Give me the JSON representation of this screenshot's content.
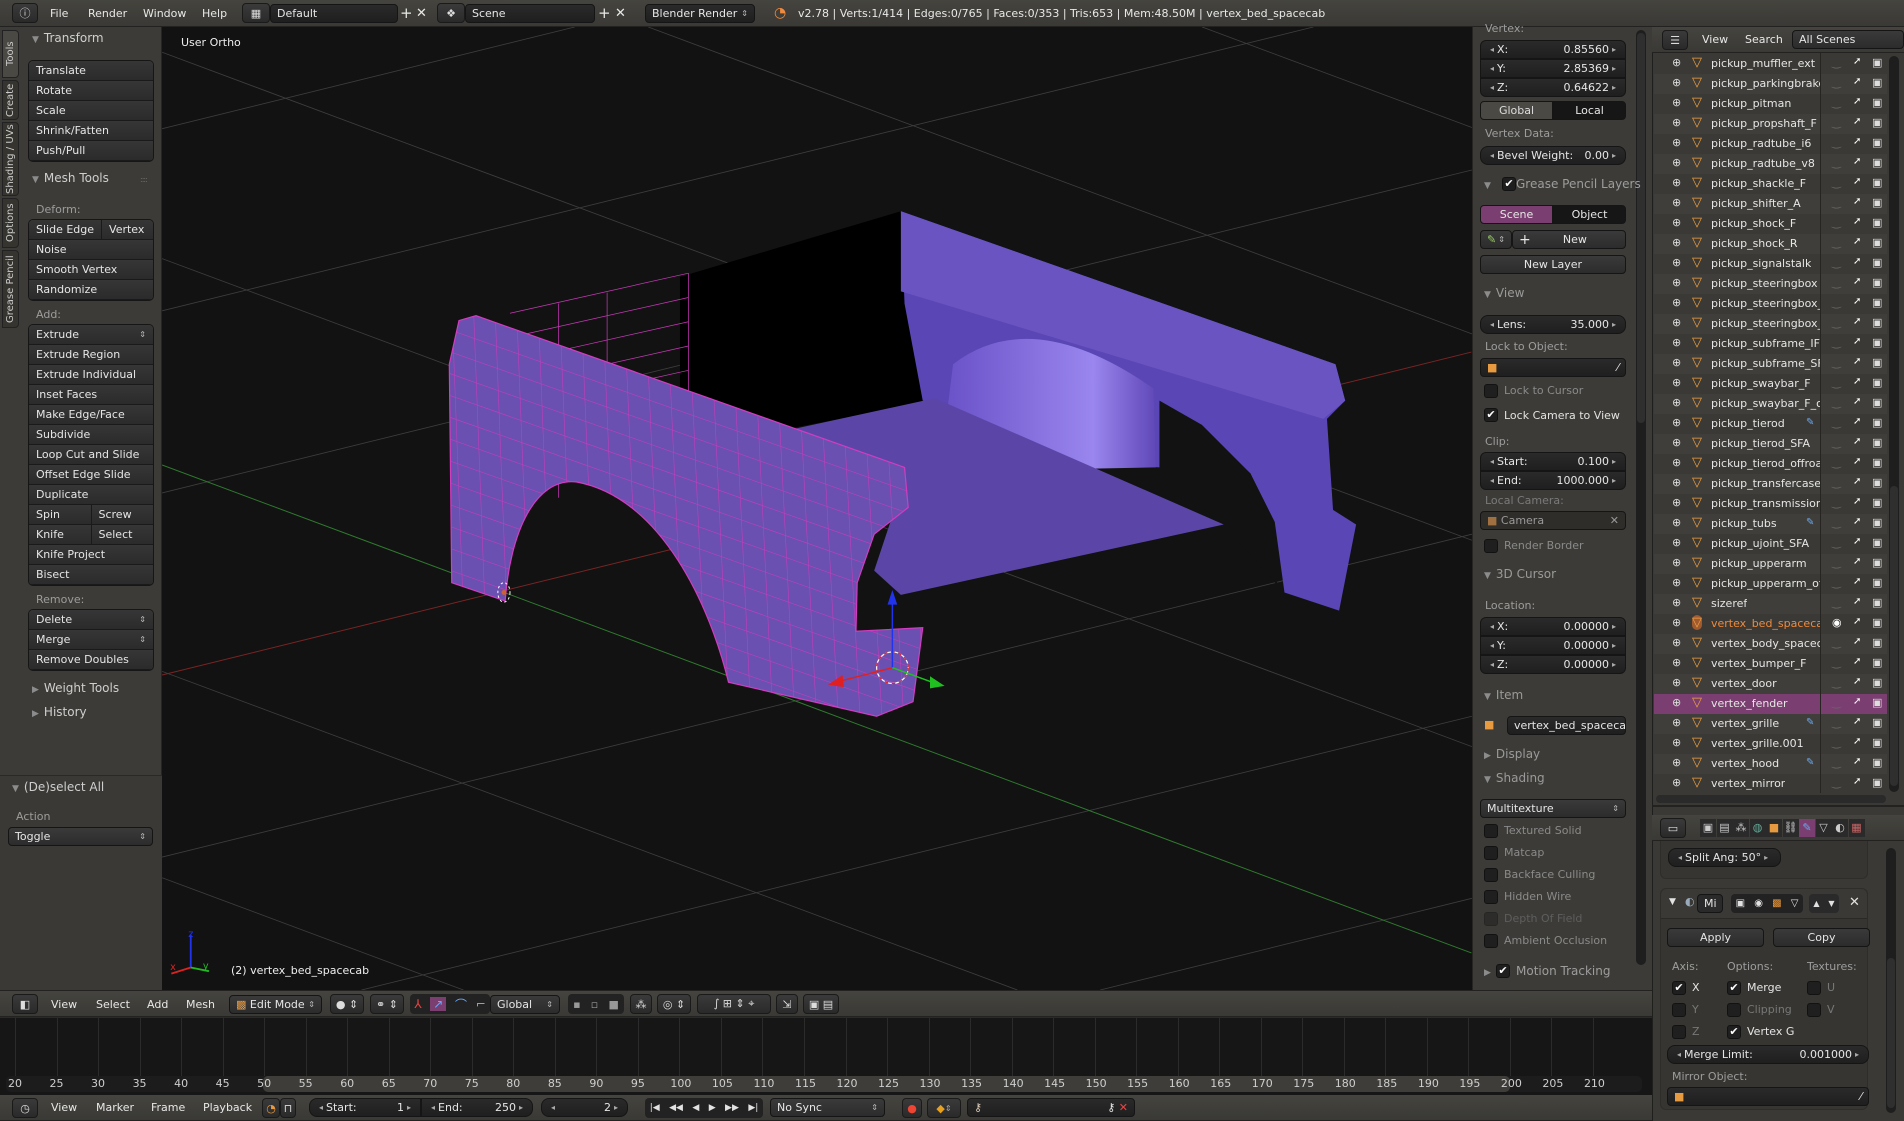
{
  "topbar": {
    "menus": [
      "File",
      "Render",
      "Window",
      "Help"
    ],
    "layout": "Default",
    "scene": "Scene",
    "engine": "Blender Render",
    "stats": "v2.78 | Verts:1/414 | Edges:0/765 | Faces:0/353 | Tris:653 | Mem:48.50M | vertex_bed_spacecab"
  },
  "toolshelf": {
    "tabs": [
      "Tools",
      "Create",
      "Shading / UVs",
      "Options",
      "Grease Pencil"
    ],
    "transform": {
      "title": "Transform",
      "items": [
        "Translate",
        "Rotate",
        "Scale",
        "Shrink/Fatten",
        "Push/Pull"
      ]
    },
    "mesh_tools": {
      "title": "Mesh Tools",
      "deform_label": "Deform:",
      "deform": [
        [
          "Slide Edge",
          "Vertex"
        ],
        "Noise",
        "Smooth Vertex",
        "Randomize"
      ],
      "add_label": "Add:",
      "add": [
        {
          "label": "Extrude",
          "dropdown": true
        },
        "Extrude Region",
        "Extrude Individual",
        "Inset Faces",
        "Make Edge/Face",
        "Subdivide",
        "Loop Cut and Slide",
        "Offset Edge Slide",
        "Duplicate",
        [
          "Spin",
          "Screw"
        ],
        [
          "Knife",
          "Select"
        ],
        "Knife Project",
        "Bisect"
      ],
      "remove_label": "Remove:",
      "remove": [
        {
          "label": "Delete",
          "dropdown": true
        },
        {
          "label": "Merge",
          "dropdown": true
        },
        "Remove Doubles"
      ]
    },
    "weight_tools": "Weight Tools",
    "history": "History",
    "operator": {
      "title": "(De)select All",
      "action_label": "Action",
      "action_value": "Toggle"
    }
  },
  "viewport": {
    "view_label": "User Ortho",
    "object_label": "(2) vertex_bed_spacecab",
    "axis": {
      "x": "x",
      "y": "y",
      "z": "z"
    }
  },
  "npanel": {
    "vertex_label": "Vertex:",
    "vertex": {
      "x": "0.85560",
      "y": "2.85369",
      "z": "0.64622"
    },
    "coord_labels": {
      "x": "X:",
      "y": "Y:",
      "z": "Z:"
    },
    "space": [
      "Global",
      "Local"
    ],
    "space_active": "Local",
    "vertex_data_label": "Vertex Data:",
    "bevel_weight_label": "Bevel Weight:",
    "bevel_weight": "0.00",
    "grease_pencil": {
      "title": "Grease Pencil Layers",
      "enabled": true,
      "tabs": [
        "Scene",
        "Object"
      ],
      "active": "Scene",
      "new_label": "New",
      "new_layer_label": "New Layer"
    },
    "view": {
      "title": "View",
      "lens_label": "Lens:",
      "lens": "35.000",
      "lock_object_label": "Lock to Object:",
      "lock_cursor": {
        "label": "Lock to Cursor",
        "checked": false
      },
      "lock_camera": {
        "label": "Lock Camera to View",
        "checked": true
      },
      "clip_label": "Clip:",
      "start_label": "Start:",
      "clip_start": "0.100",
      "end_label": "End:",
      "clip_end": "1000.000",
      "local_camera_label": "Local Camera:",
      "local_camera": "Camera",
      "render_border": {
        "label": "Render Border",
        "checked": false
      }
    },
    "cursor": {
      "title": "3D Cursor",
      "location_label": "Location:",
      "x": "0.00000",
      "y": "0.00000",
      "z": "0.00000"
    },
    "item": {
      "title": "Item",
      "name": "vertex_bed_spacecab"
    },
    "display": {
      "title": "Display"
    },
    "shading": {
      "title": "Shading",
      "mode": "Multitexture",
      "options": [
        {
          "label": "Textured Solid",
          "checked": false
        },
        {
          "label": "Matcap",
          "checked": false
        },
        {
          "label": "Backface Culling",
          "checked": false
        },
        {
          "label": "Hidden Wire",
          "checked": false
        },
        {
          "label": "Depth Of Field",
          "checked": false,
          "disabled": true
        },
        {
          "label": "Ambient Occlusion",
          "checked": false
        }
      ]
    },
    "motion_tracking": {
      "title": "Motion Tracking",
      "checked": true
    }
  },
  "outliner": {
    "menus": [
      "View",
      "Search"
    ],
    "filter": "All Scenes",
    "items": [
      {
        "name": "pickup_muffler_ext"
      },
      {
        "name": "pickup_parkingbrake"
      },
      {
        "name": "pickup_pitman"
      },
      {
        "name": "pickup_propshaft_F"
      },
      {
        "name": "pickup_radtube_i6"
      },
      {
        "name": "pickup_radtube_v8"
      },
      {
        "name": "pickup_shackle_F"
      },
      {
        "name": "pickup_shifter_A"
      },
      {
        "name": "pickup_shock_F"
      },
      {
        "name": "pickup_shock_R"
      },
      {
        "name": "pickup_signalstalk"
      },
      {
        "name": "pickup_steeringbox"
      },
      {
        "name": "pickup_steeringbox_SF"
      },
      {
        "name": "pickup_steeringbox_offr"
      },
      {
        "name": "pickup_subframe_IFS"
      },
      {
        "name": "pickup_subframe_SFA"
      },
      {
        "name": "pickup_swaybar_F"
      },
      {
        "name": "pickup_swaybar_F_offro"
      },
      {
        "name": "pickup_tierod",
        "modifier": true
      },
      {
        "name": "pickup_tierod_SFA"
      },
      {
        "name": "pickup_tierod_offroad"
      },
      {
        "name": "pickup_transfercase"
      },
      {
        "name": "pickup_transmission"
      },
      {
        "name": "pickup_tubs",
        "modifier": true
      },
      {
        "name": "pickup_ujoint_SFA"
      },
      {
        "name": "pickup_upperarm"
      },
      {
        "name": "pickup_upperarm_offroa"
      },
      {
        "name": "sizeref"
      },
      {
        "name": "vertex_bed_spacecab",
        "active": true,
        "visible": true
      },
      {
        "name": "vertex_body_spacecab"
      },
      {
        "name": "vertex_bumper_F"
      },
      {
        "name": "vertex_door"
      },
      {
        "name": "vertex_fender",
        "selected": true
      },
      {
        "name": "vertex_grille",
        "modifier": true
      },
      {
        "name": "vertex_grille.001"
      },
      {
        "name": "vertex_hood",
        "modifier": true
      },
      {
        "name": "vertex_mirror"
      }
    ]
  },
  "properties": {
    "tabs": [
      "render",
      "render-layers",
      "scene",
      "world",
      "object",
      "constraints",
      "modifiers",
      "data",
      "material",
      "texture"
    ],
    "active_tab": "modifiers",
    "split_angle": "Split Ang: 50°",
    "modifier": {
      "name": "Mi",
      "apply_label": "Apply",
      "copy_label": "Copy",
      "axis_label": "Axis:",
      "options_label": "Options:",
      "textures_label": "Textures:",
      "axis": [
        {
          "label": "X",
          "checked": true
        },
        {
          "label": "Y",
          "checked": false
        },
        {
          "label": "Z",
          "checked": false
        }
      ],
      "options": [
        {
          "label": "Merge",
          "checked": true
        },
        {
          "label": "Clipping",
          "checked": false
        },
        {
          "label": "Vertex G",
          "checked": true
        }
      ],
      "textures": [
        {
          "label": "U",
          "checked": false
        },
        {
          "label": "V",
          "checked": false
        }
      ],
      "merge_limit_label": "Merge Limit:",
      "merge_limit": "0.001000",
      "mirror_object_label": "Mirror Object:"
    }
  },
  "view3d_header": {
    "menus": [
      "View",
      "Select",
      "Add",
      "Mesh"
    ],
    "mode": "Edit Mode",
    "orientation": "Global"
  },
  "timeline": {
    "frames": [
      20,
      25,
      30,
      35,
      40,
      45,
      50,
      55,
      60,
      65,
      70,
      75,
      80,
      85,
      90,
      95,
      100,
      105,
      110,
      115,
      120,
      125,
      130,
      135,
      140,
      145,
      150,
      155,
      160,
      165,
      170,
      175,
      180,
      185,
      190,
      195,
      200,
      205,
      210
    ],
    "menus": [
      "View",
      "Marker",
      "Frame",
      "Playback"
    ],
    "start_label": "Start:",
    "start": "1",
    "end_label": "End:",
    "end": "250",
    "current": "2",
    "sync": "No Sync"
  },
  "colors": {
    "mesh": "#6a52c0",
    "wire": "#d23cc0",
    "selection": "#7a3f70",
    "active_text": "#f08a3c",
    "accent_tab": "#7a3f70"
  }
}
